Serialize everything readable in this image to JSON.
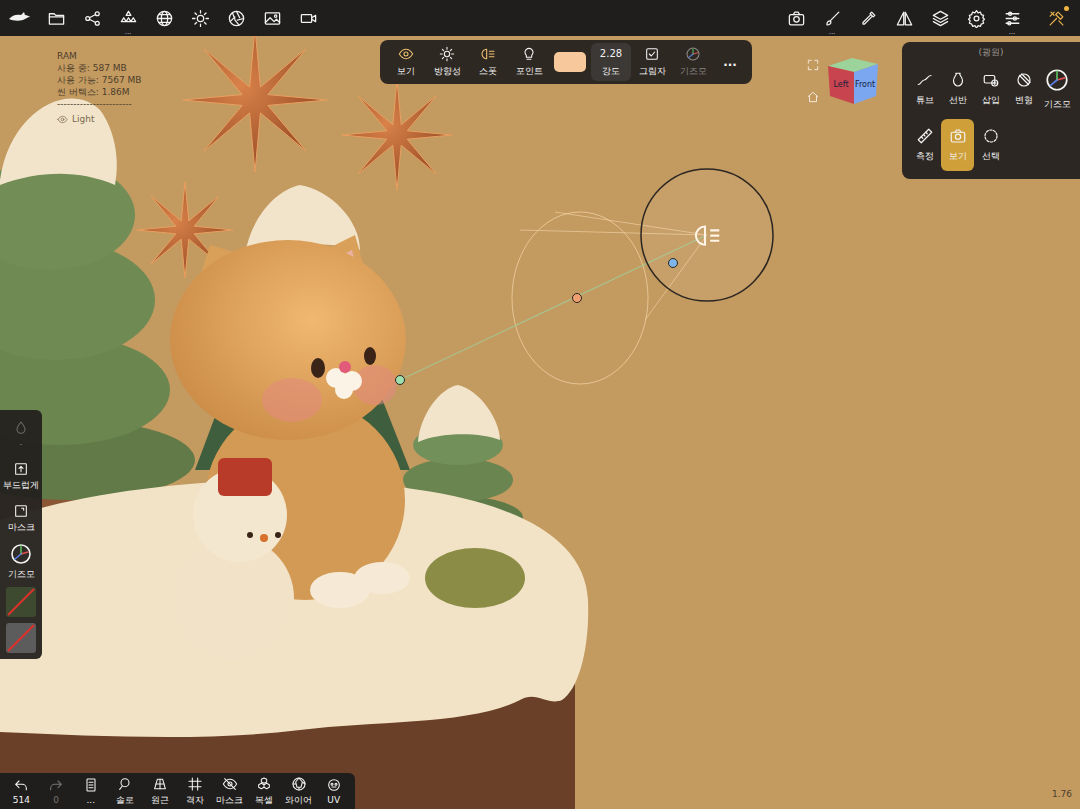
{
  "top_bar": {
    "left_tools": [
      {
        "more": ""
      },
      {
        "more": ""
      },
      {
        "more": ""
      },
      {
        "more": "..."
      },
      {
        "more": ""
      },
      {
        "more": ""
      },
      {
        "more": ""
      },
      {
        "more": ""
      },
      {
        "more": ""
      }
    ],
    "right_tools": [
      {
        "more": ""
      },
      {
        "more": "..."
      },
      {
        "more": ""
      },
      {
        "more": ""
      },
      {
        "more": ""
      },
      {
        "more": ""
      },
      {
        "more": "..."
      },
      {
        "more": ""
      }
    ],
    "notification": true
  },
  "stats": {
    "lines": [
      "RAM",
      "사용 중: 587 MB",
      "사용 가능: 7567 MB",
      "씬 버텍스: 1.86M",
      "-----------------------"
    ],
    "object": {
      "label": "Light",
      "visible": true
    }
  },
  "light_toolbar": {
    "items": [
      {
        "kind": "button",
        "label": "보기",
        "active": true,
        "disabled": false,
        "selected": false
      },
      {
        "kind": "button",
        "label": "방향성",
        "active": false,
        "disabled": false,
        "selected": false
      },
      {
        "kind": "button",
        "label": "스폿",
        "active": true,
        "disabled": false,
        "selected": false
      },
      {
        "kind": "button",
        "label": "포인트",
        "active": false,
        "disabled": false,
        "selected": false
      },
      {
        "kind": "swatch",
        "color": "#f6c89c"
      },
      {
        "kind": "value",
        "value": "2.28",
        "label": "강도",
        "selected": true
      },
      {
        "kind": "checkbox",
        "label": "그림자",
        "checked": true
      },
      {
        "kind": "button",
        "label": "기즈모",
        "active": false,
        "disabled": true,
        "selected": false
      },
      {
        "kind": "more",
        "label": "..."
      }
    ]
  },
  "right_panel": {
    "title": "(광원)",
    "items": [
      {
        "label": "튜브",
        "selected": false
      },
      {
        "label": "선반",
        "selected": false
      },
      {
        "label": "삽입",
        "selected": false
      },
      {
        "label": "변형",
        "selected": false
      },
      {
        "label": "기즈모",
        "selected": false
      },
      {
        "label": "측정",
        "selected": false
      },
      {
        "label": "보기",
        "selected": true
      },
      {
        "label": "선택",
        "selected": false
      }
    ]
  },
  "left_sidebar": {
    "items": [
      {
        "kind": "button",
        "label": "-",
        "disabled": true
      },
      {
        "kind": "button",
        "label": "부드럽게",
        "disabled": false
      },
      {
        "kind": "button",
        "label": "마스크",
        "disabled": false
      },
      {
        "kind": "button",
        "label": "기즈모",
        "disabled": false
      },
      {
        "kind": "swatch",
        "color": "#3e4a30",
        "empty": true
      },
      {
        "kind": "swatch",
        "color": "#5c5c5c",
        "empty": true
      }
    ]
  },
  "bottom_bar": {
    "items": [
      {
        "label": "514",
        "disabled": false
      },
      {
        "label": "0",
        "disabled": true
      },
      {
        "label": "...",
        "disabled": false
      },
      {
        "label": "솔로",
        "disabled": false
      },
      {
        "label": "원근",
        "disabled": false
      },
      {
        "label": "격자",
        "disabled": false
      },
      {
        "label": "마스크",
        "disabled": false
      },
      {
        "label": "복셀",
        "disabled": false
      },
      {
        "label": "와이어",
        "disabled": false
      },
      {
        "label": "UV",
        "disabled": false
      }
    ]
  },
  "nav_cube": {
    "faces": [
      "Left",
      "Front"
    ]
  },
  "zoom": "1.76"
}
